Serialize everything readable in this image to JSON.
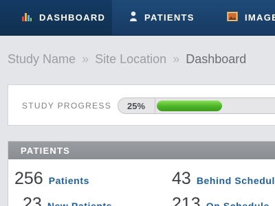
{
  "nav": {
    "items": [
      {
        "label": "DASHBOARD",
        "icon": "bar-chart-icon",
        "active": true
      },
      {
        "label": "PATIENTS",
        "icon": "person-icon",
        "active": false
      },
      {
        "label": "IMAGES",
        "icon": "image-icon",
        "active": false
      }
    ]
  },
  "breadcrumb": {
    "study": "Study Name",
    "site": "Site Location",
    "current": "Dashboard",
    "separator": "»"
  },
  "progress": {
    "label": "STUDY PROGRESS",
    "value_text": "25%",
    "value": 0.25
  },
  "patients": {
    "title": "PATIENTS",
    "stats": [
      {
        "count": "256",
        "label": "Patients"
      },
      {
        "count": "43",
        "label": "Behind Schedule"
      },
      {
        "count": "23",
        "label": "New Patients"
      },
      {
        "count": "213",
        "label": "On Schedule"
      }
    ]
  },
  "colors": {
    "nav_bg": "#1e4a78",
    "progress_fill": "#4cb527",
    "link": "#1f5f9c",
    "panel_header": "#9a9da2"
  }
}
